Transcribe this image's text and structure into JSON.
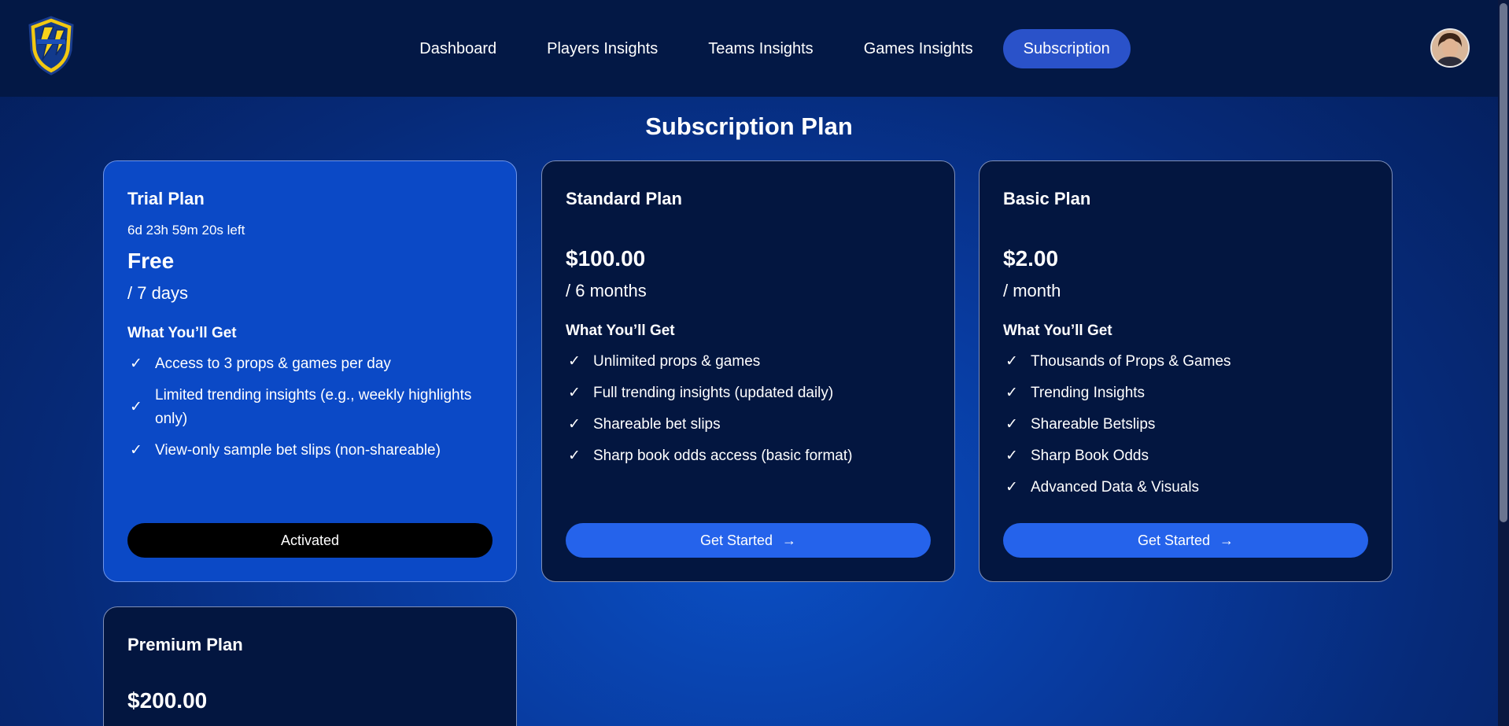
{
  "nav": {
    "items": [
      {
        "label": "Dashboard",
        "active": false
      },
      {
        "label": "Players Insights",
        "active": false
      },
      {
        "label": "Teams Insights",
        "active": false
      },
      {
        "label": "Games Insights",
        "active": false
      },
      {
        "label": "Subscription",
        "active": true
      }
    ]
  },
  "page": {
    "title": "Subscription Plan"
  },
  "plans": [
    {
      "name": "Trial Plan",
      "timer": "6d 23h 59m 20s left",
      "price": "Free",
      "period": "/ 7 days",
      "features_heading": "What You’ll Get",
      "features": [
        "Access to 3 props & games per day",
        "Limited trending insights (e.g., weekly highlights only)",
        "View-only sample bet slips (non-shareable)"
      ],
      "button": "Activated"
    },
    {
      "name": "Standard Plan",
      "price": "$100.00",
      "period": "/ 6 months",
      "features_heading": "What You’ll Get",
      "features": [
        "Unlimited props & games",
        "Full trending insights (updated daily)",
        "Shareable bet slips",
        "Sharp book odds access (basic format)"
      ],
      "button": "Get Started"
    },
    {
      "name": "Basic Plan",
      "price": "$2.00",
      "period": "/ month",
      "features_heading": "What You’ll Get",
      "features": [
        "Thousands of Props & Games",
        "Trending Insights",
        "Shareable Betslips",
        "Sharp Book Odds",
        "Advanced Data & Visuals"
      ],
      "button": "Get Started"
    },
    {
      "name": "Premium Plan",
      "price": "$200.00"
    }
  ],
  "colors": {
    "topbar": "#031845",
    "accent_nav": "#2a52c9",
    "button_blue": "#2563eb",
    "card_dark": "#031640",
    "card_highlight": "#0b49c6"
  },
  "icons": {
    "check": "check-icon",
    "arrow": "arrow-right-icon",
    "logo": "lightning-shield-logo"
  }
}
